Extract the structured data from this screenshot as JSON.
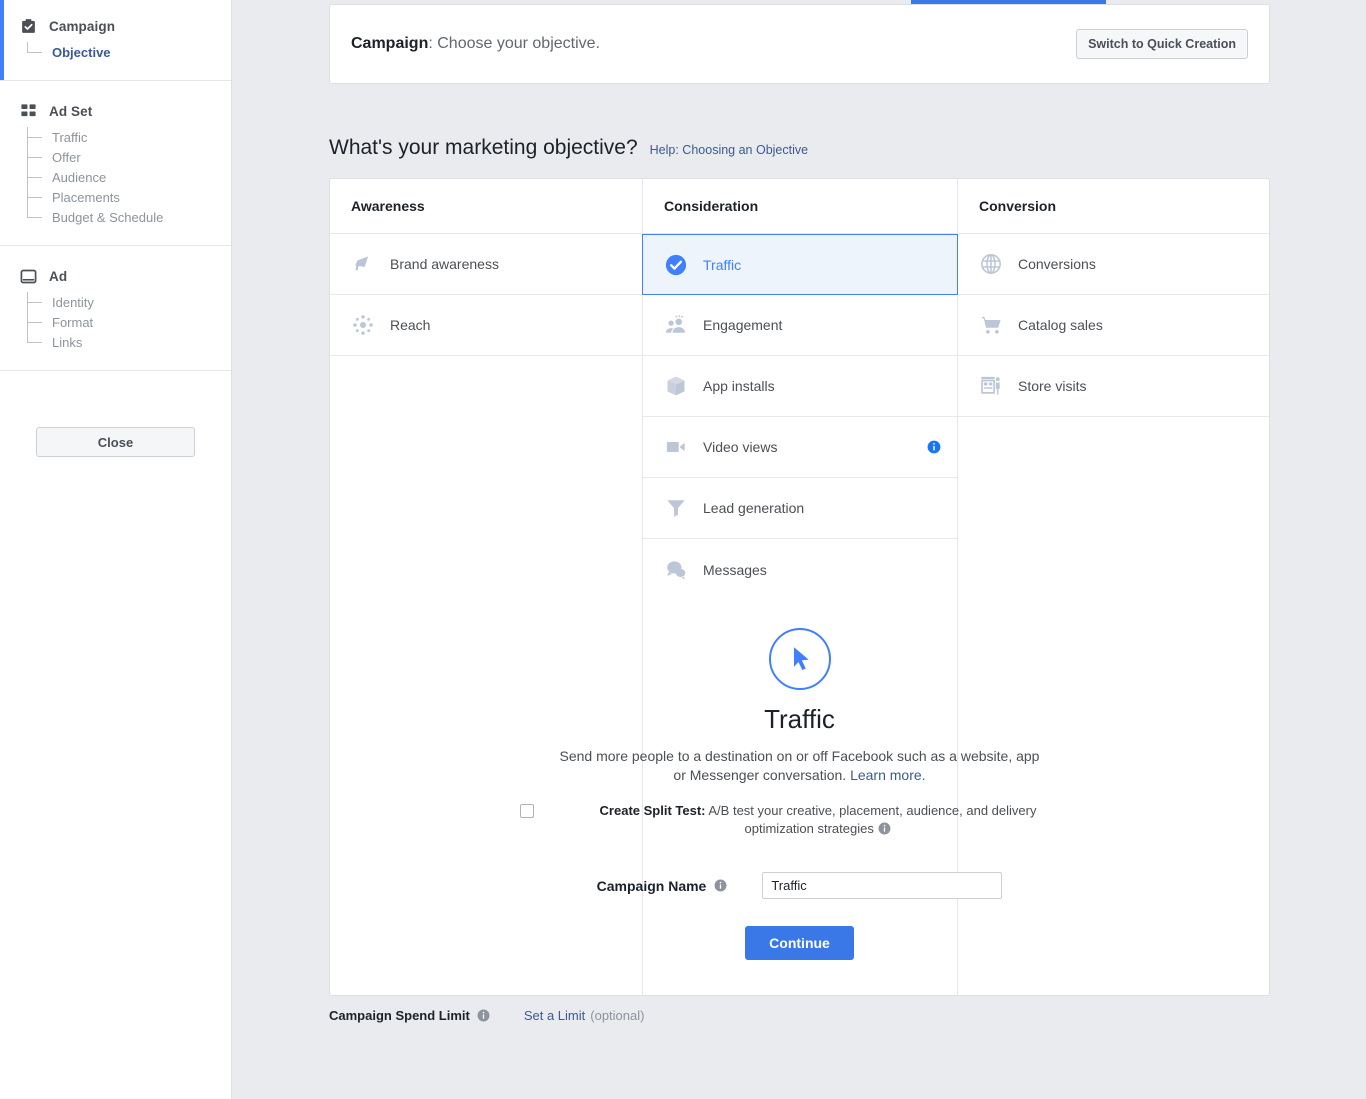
{
  "progress": {
    "percent": 21
  },
  "sidebar": {
    "sections": [
      {
        "title": "Campaign",
        "icon": "clipboard-check-icon",
        "active": true,
        "items": [
          {
            "label": "Objective",
            "current": true
          }
        ]
      },
      {
        "title": "Ad Set",
        "icon": "grid-squares-icon",
        "active": false,
        "items": [
          {
            "label": "Traffic",
            "current": false
          },
          {
            "label": "Offer",
            "current": false
          },
          {
            "label": "Audience",
            "current": false
          },
          {
            "label": "Placements",
            "current": false
          },
          {
            "label": "Budget & Schedule",
            "current": false
          }
        ]
      },
      {
        "title": "Ad",
        "icon": "window-icon",
        "active": false,
        "items": [
          {
            "label": "Identity",
            "current": false
          },
          {
            "label": "Format",
            "current": false
          },
          {
            "label": "Links",
            "current": false
          }
        ]
      }
    ],
    "close_label": "Close"
  },
  "header": {
    "title_bold": "Campaign",
    "title_rest": ": Choose your objective.",
    "quick_creation_label": "Switch to Quick Creation"
  },
  "objective": {
    "heading": "What's your marketing objective?",
    "help_link": "Help: Choosing an Objective",
    "columns": [
      {
        "header": "Awareness",
        "options": [
          {
            "label": "Brand awareness",
            "icon": "megaphone-icon",
            "selected": false,
            "info": false
          },
          {
            "label": "Reach",
            "icon": "burst-icon",
            "selected": false,
            "info": false
          }
        ]
      },
      {
        "header": "Consideration",
        "options": [
          {
            "label": "Traffic",
            "icon": "check-circle-icon",
            "selected": true,
            "info": false
          },
          {
            "label": "Engagement",
            "icon": "people-icon",
            "selected": false,
            "info": false
          },
          {
            "label": "App installs",
            "icon": "box-icon",
            "selected": false,
            "info": false
          },
          {
            "label": "Video views",
            "icon": "video-camera-icon",
            "selected": false,
            "info": true
          },
          {
            "label": "Lead generation",
            "icon": "funnel-icon",
            "selected": false,
            "info": false
          },
          {
            "label": "Messages",
            "icon": "chat-bubbles-icon",
            "selected": false,
            "info": false
          }
        ]
      },
      {
        "header": "Conversion",
        "options": [
          {
            "label": "Conversions",
            "icon": "globe-icon",
            "selected": false,
            "info": false
          },
          {
            "label": "Catalog sales",
            "icon": "shopping-cart-icon",
            "selected": false,
            "info": false
          },
          {
            "label": "Store visits",
            "icon": "storefront-icon",
            "selected": false,
            "info": false
          }
        ]
      }
    ]
  },
  "detail": {
    "icon": "cursor-arrow-icon",
    "title": "Traffic",
    "description": "Send more people to a destination on or off Facebook such as a website, app or Messenger conversation.",
    "learn_more": "Learn more.",
    "split_test_bold": "Create Split Test:",
    "split_test_rest": "A/B test your creative, placement, audience, and delivery optimization strategies",
    "split_test_checked": false,
    "campaign_name_label": "Campaign Name",
    "campaign_name_value": "Traffic",
    "campaign_name_placeholder": "Campaign Name",
    "continue_label": "Continue"
  },
  "footer": {
    "spend_limit_label": "Campaign Spend Limit",
    "set_limit_link": "Set a Limit",
    "optional_text": "(optional)"
  },
  "colors": {
    "accent_blue": "#4080ff",
    "button_blue": "#3b78e7",
    "link_blue": "#3b5998",
    "page_bg": "#e9ebee",
    "icon_gray": "#bdc6d6"
  }
}
